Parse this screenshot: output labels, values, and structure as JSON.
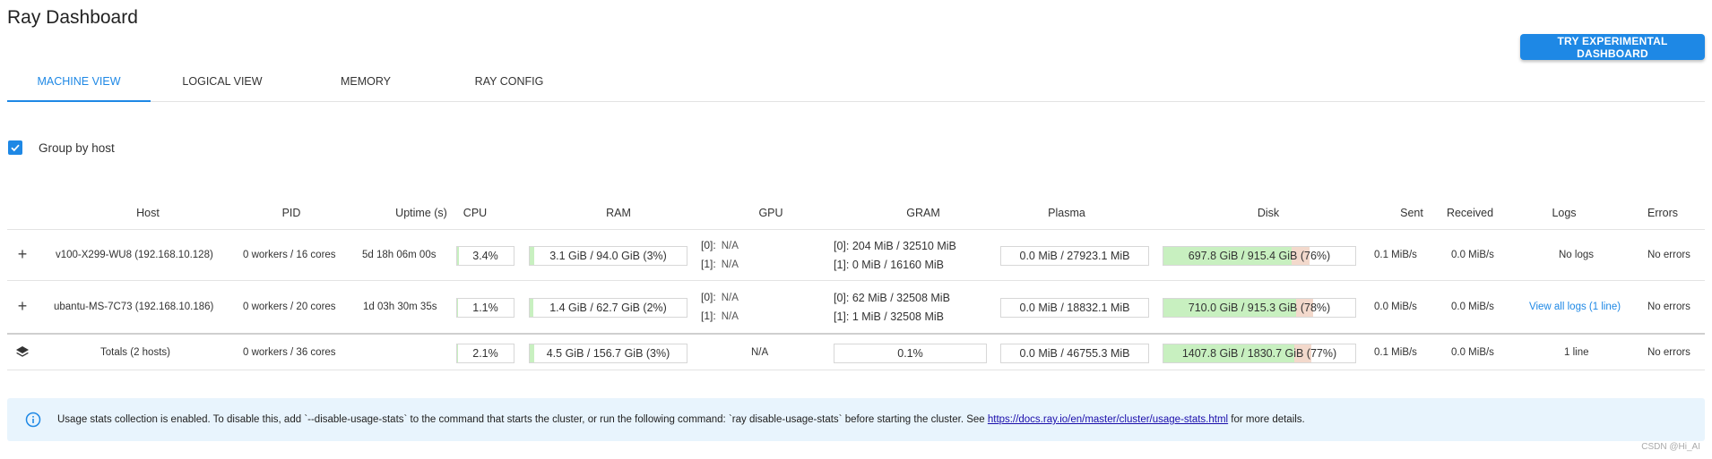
{
  "header": {
    "title": "Ray Dashboard",
    "experimental_button": "TRY EXPERIMENTAL DASHBOARD"
  },
  "tabs": [
    {
      "label": "MACHINE VIEW",
      "active": true
    },
    {
      "label": "LOGICAL VIEW",
      "active": false
    },
    {
      "label": "MEMORY",
      "active": false
    },
    {
      "label": "RAY CONFIG",
      "active": false
    }
  ],
  "group_by_host": {
    "label": "Group by host",
    "checked": true
  },
  "table": {
    "columns": [
      "Host",
      "PID",
      "Uptime (s)",
      "CPU",
      "RAM",
      "GPU",
      "GRAM",
      "Plasma",
      "Disk",
      "Sent",
      "Received",
      "Logs",
      "Errors"
    ],
    "rows": [
      {
        "expand": "+",
        "host": "v100-X299-WU8 (192.168.10.128)",
        "pid": "0 workers / 16 cores",
        "uptime": "5d 18h 06m 00s",
        "cpu": "3.4%",
        "cpu_frac": 0.034,
        "ram": "3.1 GiB / 94.0 GiB (3%)",
        "ram_frac": 0.03,
        "gpu": [
          {
            "idx": "[0]:",
            "val": "N/A"
          },
          {
            "idx": "[1]:",
            "val": "N/A"
          }
        ],
        "gram": [
          "[0]: 204 MiB / 32510 MiB",
          "[1]: 0 MiB / 16160 MiB"
        ],
        "plasma": "0.0 MiB / 27923.1 MiB",
        "disk": "697.8 GiB / 915.4 GiB (76%)",
        "disk_frac": 0.76,
        "sent": "0.1 MiB/s",
        "received": "0.0 MiB/s",
        "logs": "No logs",
        "errors": "No errors"
      },
      {
        "expand": "+",
        "host": "ubantu-MS-7C73 (192.168.10.186)",
        "pid": "0 workers / 20 cores",
        "uptime": "1d 03h 30m 35s",
        "cpu": "1.1%",
        "cpu_frac": 0.011,
        "ram": "1.4 GiB / 62.7 GiB (2%)",
        "ram_frac": 0.02,
        "gpu": [
          {
            "idx": "[0]:",
            "val": "N/A"
          },
          {
            "idx": "[1]:",
            "val": "N/A"
          }
        ],
        "gram": [
          "[0]: 62 MiB / 32508 MiB",
          "[1]: 1 MiB / 32508 MiB"
        ],
        "plasma": "0.0 MiB / 18832.1 MiB",
        "disk": "710.0 GiB / 915.3 GiB (78%)",
        "disk_frac": 0.78,
        "sent": "0.0 MiB/s",
        "received": "0.0 MiB/s",
        "logs": "View all logs (1 line)",
        "errors": "No errors"
      }
    ],
    "totals": {
      "host": "Totals (2 hosts)",
      "pid": "0 workers / 36 cores",
      "cpu": "2.1%",
      "cpu_frac": 0.021,
      "ram": "4.5 GiB / 156.7 GiB (3%)",
      "ram_frac": 0.03,
      "gpu": "N/A",
      "gram": "0.1%",
      "plasma": "0.0 MiB / 46755.3 MiB",
      "disk": "1407.8 GiB / 1830.7 GiB (77%)",
      "disk_frac": 0.77,
      "sent": "0.1 MiB/s",
      "received": "0.0 MiB/s",
      "logs": "1 line",
      "errors": "No errors"
    }
  },
  "notice": {
    "text_before": "Usage stats collection is enabled. To disable this, add `--disable-usage-stats` to the command that starts the cluster, or run the following command: `ray disable-usage-stats` before starting the cluster. See ",
    "link": "https://docs.ray.io/en/master/cluster/usage-stats.html",
    "text_after": " for more details."
  },
  "watermark": "CSDN @Hi_AI",
  "colors": {
    "accent": "#1e88e5",
    "bar_green": "#c8f0c0",
    "bar_orange": "#f3d9cc",
    "notice_bg": "#e8f4fd"
  }
}
